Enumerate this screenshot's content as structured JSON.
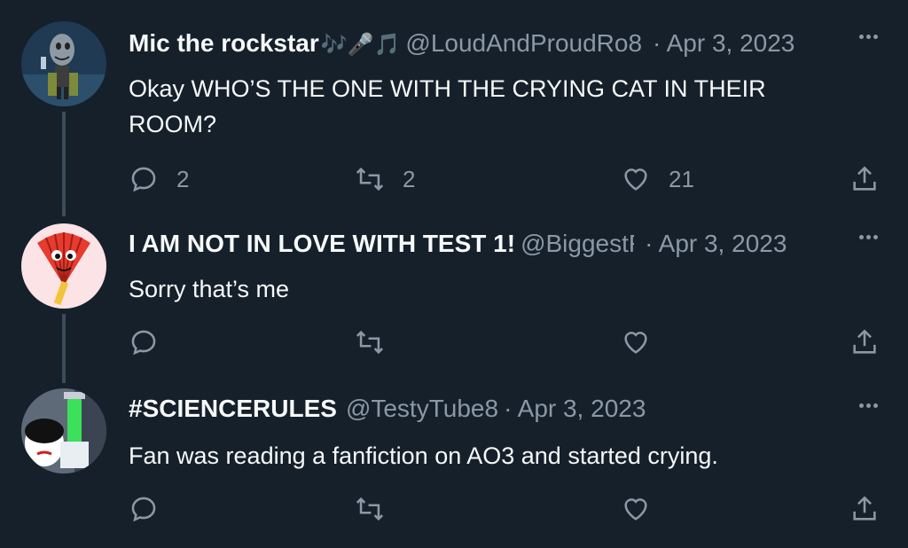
{
  "tweets": [
    {
      "name": "Mic the rockstar",
      "emoji": "🎶🎤🎵",
      "handle": "@LoudAndProudRo8",
      "date": "· Apr 3, 2023",
      "text": "Okay WHO’S THE ONE WITH THE CRYING CAT IN THEIR ROOM?",
      "replies": "2",
      "retweets": "2",
      "likes": "21"
    },
    {
      "name": "I AM NOT IN LOVE WITH TEST 1!",
      "emoji": "",
      "handle": "@BiggestFan",
      "date": "· Apr 3, 2023",
      "text": "Sorry that’s me",
      "replies": "",
      "retweets": "",
      "likes": ""
    },
    {
      "name": "#SCIENCERULES",
      "emoji": "",
      "handle": "@TestyTube8",
      "date": "· Apr 3, 2023",
      "text": "Fan was reading a fanfiction on AO3 and started crying.",
      "replies": "",
      "retweets": "",
      "likes": ""
    }
  ],
  "icons": {
    "reply": "reply-icon",
    "retweet": "retweet-icon",
    "like": "heart-icon",
    "share": "share-icon",
    "more": "more-icon"
  },
  "colors": {
    "background": "#15202b",
    "text": "#f7f9f9",
    "secondary": "#8b98a5",
    "thread_line": "#3d4c5a"
  }
}
